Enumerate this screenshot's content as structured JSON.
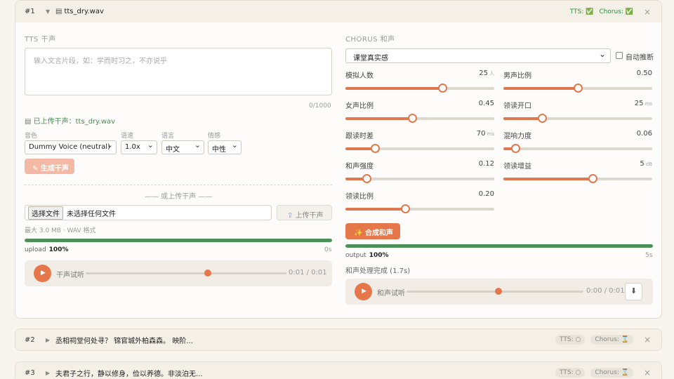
{
  "cards": [
    {
      "index": "#1",
      "title": "tts_dry.wav",
      "badges": {
        "tts": "TTS: ✅",
        "chorus": "Chorus: ✅"
      },
      "tts": {
        "section_label": "TTS 干声",
        "textarea_placeholder": "输入文言片段，如：学而时习之，不亦说乎",
        "char_count": "0/1000",
        "uploaded_text": "已上传干声：tts_dry.wav",
        "fields": {
          "voice": {
            "label": "音色",
            "value": "Dummy Voice (neutral)"
          },
          "speed": {
            "label": "语速",
            "value": "1.0x"
          },
          "language": {
            "label": "语言",
            "value": "中文"
          },
          "emotion": {
            "label": "情感",
            "value": "中性"
          }
        },
        "generate_label": "生成干声",
        "divider_text": "—— 或上传干声 ——",
        "file_button": "选择文件",
        "file_status": "未选择任何文件",
        "upload_button": "上传干声",
        "file_hint": "最大 3.0 MB · WAV 格式",
        "progress": {
          "label": "upload",
          "percent_text": "100%",
          "value": 1.0,
          "time": "0s"
        },
        "player": {
          "label": "干声试听",
          "time": "0:01 / 0:01",
          "position": 0.61
        }
      },
      "chorus": {
        "section_label": "CHORUS 和声",
        "preset": "课堂真实感",
        "auto_label": "自动推断",
        "sliders": [
          {
            "name": "模拟人数",
            "value": "25",
            "unit": "人",
            "fraction": 0.65
          },
          {
            "name": "男声比例",
            "value": "0.50",
            "unit": "",
            "fraction": 0.5
          },
          {
            "name": "女声比例",
            "value": "0.45",
            "unit": "",
            "fraction": 0.45
          },
          {
            "name": "领读开口",
            "value": "25",
            "unit": "ms",
            "fraction": 0.26
          },
          {
            "name": "跟读时差",
            "value": "70",
            "unit": "ms",
            "fraction": 0.2
          },
          {
            "name": "混响力度",
            "value": "0.06",
            "unit": "",
            "fraction": 0.08
          },
          {
            "name": "和声强度",
            "value": "0.12",
            "unit": "",
            "fraction": 0.14
          },
          {
            "name": "领读增益",
            "value": "5",
            "unit": "dB",
            "fraction": 0.6
          },
          {
            "name": "领读比例",
            "value": "0.20",
            "unit": "",
            "fraction": 0.4
          }
        ],
        "synth_label": "合成和声",
        "progress": {
          "label": "output",
          "percent_text": "100%",
          "value": 1.0,
          "time": "5s"
        },
        "status": "和声处理完成 (1.7s)",
        "player": {
          "label": "和声试听",
          "time": "0:00 / 0:01",
          "position": 0.52
        }
      }
    },
    {
      "index": "#2",
      "title": "丞相祠堂何处寻？ 锦官城外柏森森。 映阶...",
      "badges": {
        "tts": "TTS: ○",
        "chorus": "Chorus: ⌛"
      }
    },
    {
      "index": "#3",
      "title": "夫君子之行，静以修身，俭以养德。非淡泊无...",
      "badges": {
        "tts": "TTS: ○",
        "chorus": "Chorus: ⌛"
      }
    }
  ],
  "colors": {
    "accent": "#e5774a",
    "success": "#4f8f59",
    "background": "#f7f4ee"
  }
}
